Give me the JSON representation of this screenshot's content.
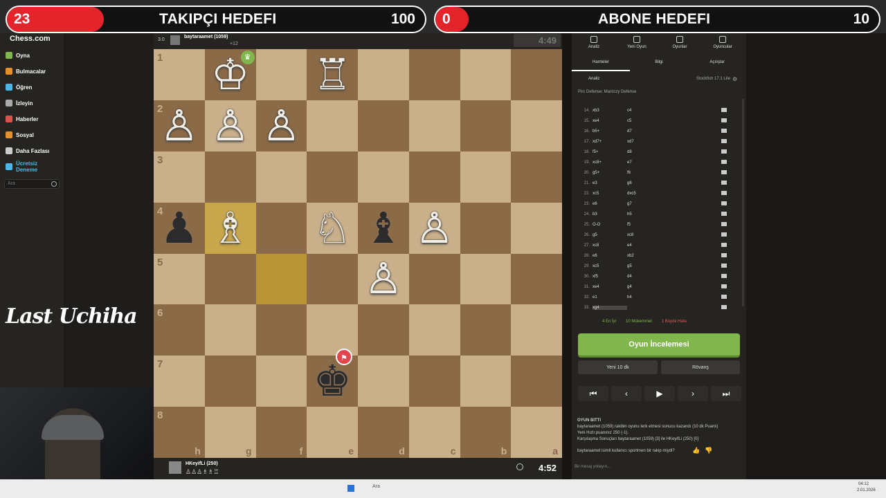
{
  "overlay": {
    "left": {
      "count": "23",
      "title": "TAKIPÇI HEDEFI",
      "goal": "100",
      "progress": 0.23
    },
    "right": {
      "count": "0",
      "title": "ABONE HEDEFI",
      "goal": "10",
      "progress": 0.0
    }
  },
  "sidebar": {
    "logo": "Chess.com",
    "items": [
      {
        "label": "Oyna",
        "color": "#81b64c"
      },
      {
        "label": "Bulmacalar",
        "color": "#e58f2a"
      },
      {
        "label": "Öğren",
        "color": "#4db6e6"
      },
      {
        "label": "İzleyin",
        "color": "#aaaaaa"
      },
      {
        "label": "Haberler",
        "color": "#d9534f"
      },
      {
        "label": "Sosyal",
        "color": "#e58f2a"
      },
      {
        "label": "Daha Fazlası",
        "color": "#cccccc"
      },
      {
        "label": "Ücretsiz Deneme",
        "color": "#4db6e6"
      }
    ],
    "search_placeholder": "Ara"
  },
  "watermark": "Last Uchiha",
  "players": {
    "top": {
      "rating_text": "3.0",
      "name": "baytaraamet (1059)",
      "clock": "4:49",
      "extra": "+12"
    },
    "bottom": {
      "name": "HKeyifLi (250)",
      "clock": "4:52"
    }
  },
  "board": {
    "ranks": [
      "1",
      "2",
      "3",
      "4",
      "5",
      "6",
      "7",
      "8"
    ],
    "files": [
      "h",
      "g",
      "f",
      "e",
      "d",
      "c",
      "b",
      "a"
    ],
    "pieces": {
      "0-1": "♔w",
      "0-3": "♖w",
      "1-0": "♙w",
      "1-1": "♙w",
      "1-2": "♙w",
      "3-0": "♟b",
      "3-1": "♗w",
      "3-3": "♘w",
      "3-4": "♝b",
      "3-5": "♙w",
      "4-4": "♙w",
      "6-3": "♚b"
    },
    "highlights": [
      "3-1",
      "4-2"
    ]
  },
  "panel": {
    "tabs": [
      "Analiz",
      "Yeni Oyun",
      "Oyunlar",
      "Oyuncular"
    ],
    "subtabs": [
      "Hamleler",
      "Bilgi",
      "Açılışlar"
    ],
    "engine_label": "Analiz",
    "engine_name": "Stockfish 17.1 Lite",
    "opening": "Pirc Defense: Maróczy Defense",
    "moves": [
      [
        "14.",
        "xb3",
        "c4"
      ],
      [
        "15.",
        "xe4",
        "c5"
      ],
      [
        "16.",
        "b5+",
        "d7"
      ],
      [
        "17.",
        "xd7+",
        "xd7"
      ],
      [
        "18.",
        "f5+",
        "d8"
      ],
      [
        "19.",
        "xc8+",
        "e7"
      ],
      [
        "20.",
        "g5+",
        "f6"
      ],
      [
        "21.",
        "e3",
        "g6"
      ],
      [
        "22.",
        "xc5",
        "dxc5"
      ],
      [
        "23.",
        "e6",
        "g7"
      ],
      [
        "24.",
        "b3",
        "h5"
      ],
      [
        "25.",
        "O-O",
        "f5"
      ],
      [
        "26.",
        "g5",
        "xc8"
      ],
      [
        "27.",
        "xc8",
        "e4"
      ],
      [
        "28.",
        "e6",
        "xb2"
      ],
      [
        "29.",
        "xc5",
        "g5"
      ],
      [
        "30.",
        "xf5",
        "d4"
      ],
      [
        "31.",
        "xe4",
        "g4"
      ],
      [
        "32.",
        "e1",
        "h4"
      ],
      [
        "33.",
        "xg4",
        ""
      ]
    ],
    "summary": {
      "best": "4 En İyi",
      "excellent": "10 Mükemmel",
      "blunder": "1 Büyük Hata"
    },
    "review_button": "Oyun İncelemesi",
    "new_game": "Yeni 10 dk",
    "rematch": "Rövanş",
    "result_title": "OYUN BITTI",
    "result_lines": [
      "baytaraamet (1059) rakibin oyunu terk etmesi sonucu kazandı (10 dk Puanlı)",
      "Yeni Hızlı puanınız 250 (-1).",
      "Karşılaşma Sonuçları baytaraamet (1059) [3] ile HKeyifLi (250) [0]"
    ],
    "question": "baytaraamet isimli kullanıcı sportmen bir rakip miydi?",
    "chat_placeholder": "Bir mesaj yollayın..."
  },
  "taskbar": {
    "search": "Ara",
    "time": "04:12",
    "date": "2.01.2026"
  }
}
